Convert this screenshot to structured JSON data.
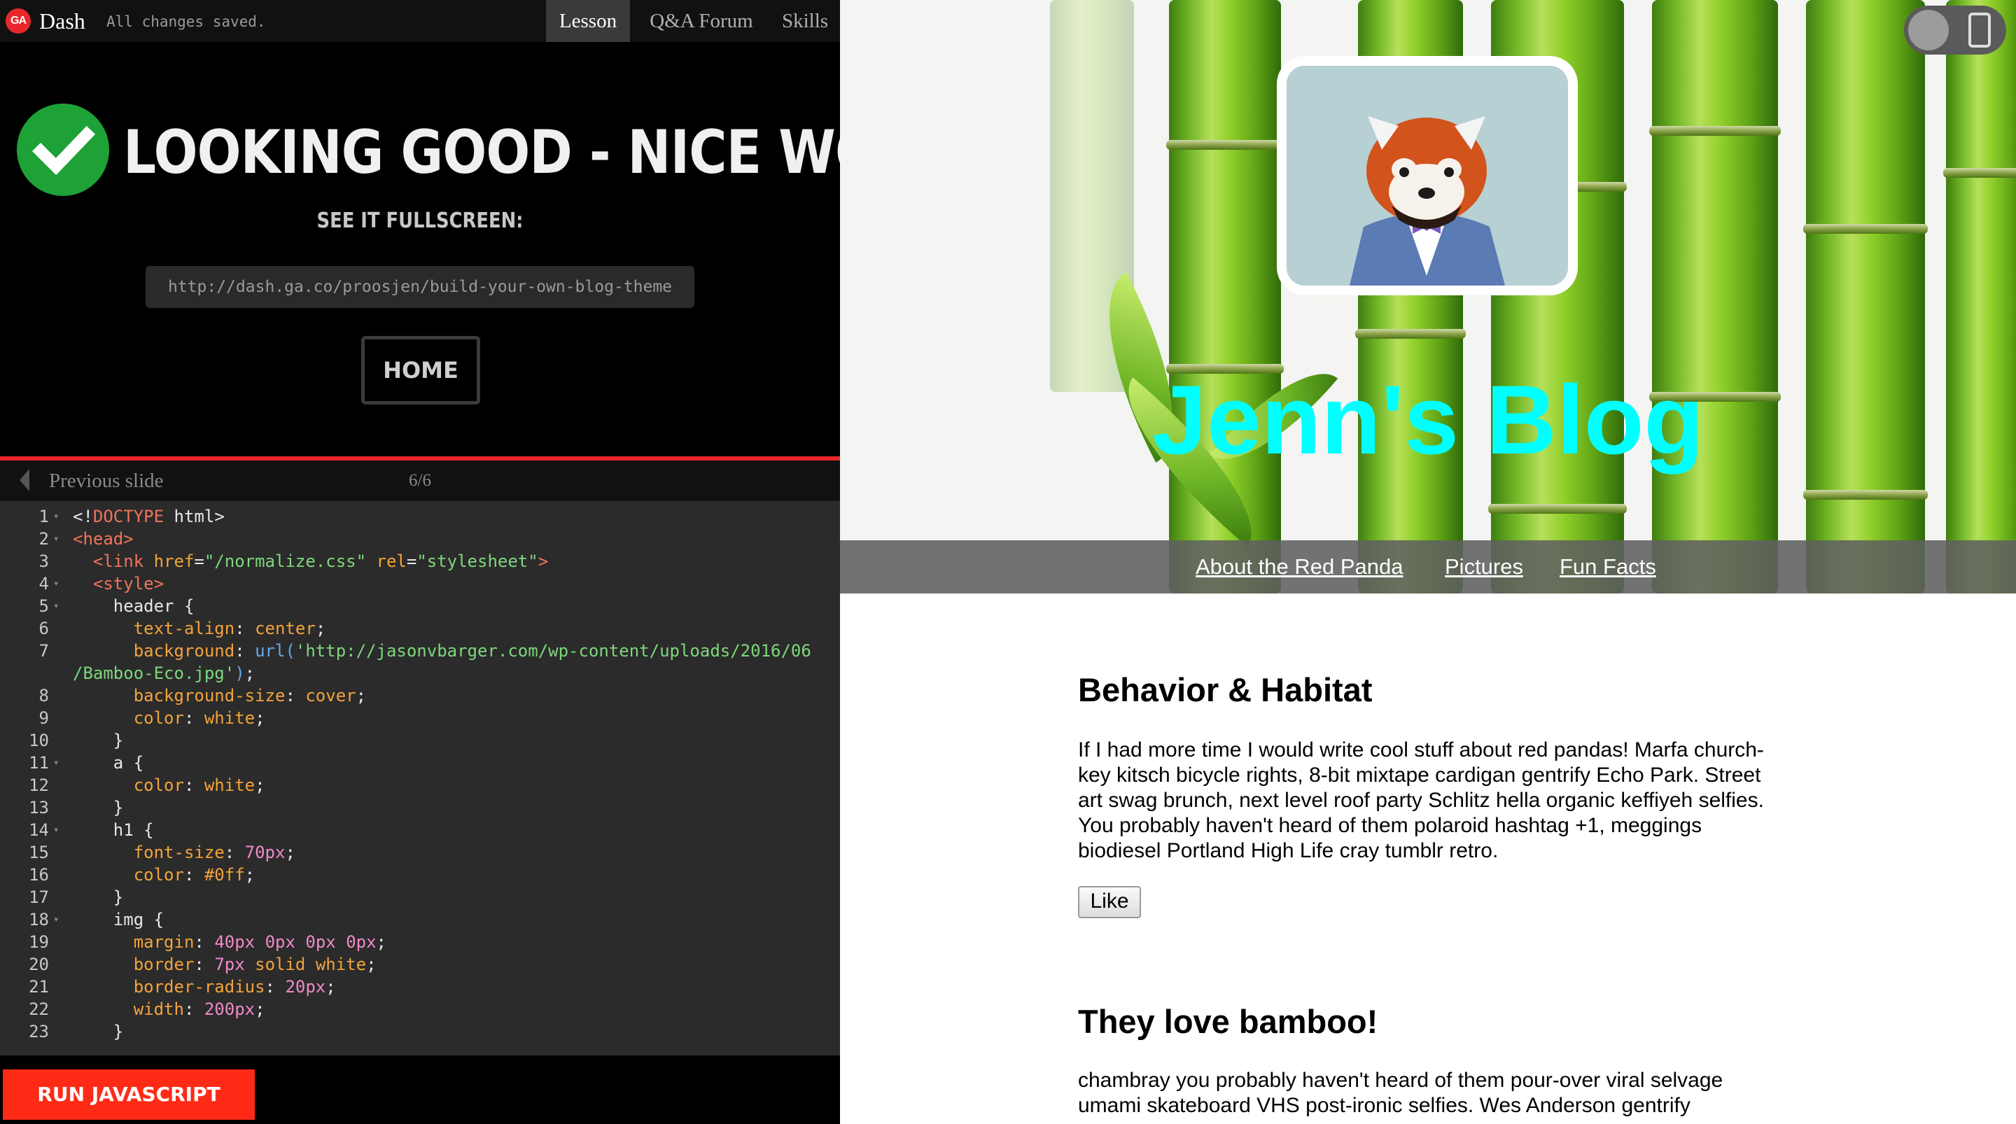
{
  "topbar": {
    "logo_text": "GA",
    "app_name": "Dash",
    "save_status": "All changes saved.",
    "tabs": [
      {
        "label": "Lesson",
        "active": true
      },
      {
        "label": "Q&A Forum",
        "active": false
      },
      {
        "label": "Skills",
        "active": false
      }
    ]
  },
  "success": {
    "title": "LOOKING GOOD - NICE WORK!",
    "fullscreen_label": "SEE IT FULLSCREEN:",
    "url": "http://dash.ga.co/proosjen/build-your-own-blog-theme",
    "home_label": "HOME"
  },
  "slide_nav": {
    "prev_label": "Previous slide",
    "counter": "6/6"
  },
  "editor": {
    "lines": [
      {
        "n": "1",
        "fold": true
      },
      {
        "n": "2",
        "fold": true
      },
      {
        "n": "3",
        "fold": false
      },
      {
        "n": "4",
        "fold": true
      },
      {
        "n": "5",
        "fold": true
      },
      {
        "n": "6",
        "fold": false
      },
      {
        "n": "7",
        "fold": false
      },
      {
        "n": "",
        "fold": false
      },
      {
        "n": "8",
        "fold": false
      },
      {
        "n": "9",
        "fold": false
      },
      {
        "n": "10",
        "fold": false
      },
      {
        "n": "11",
        "fold": true
      },
      {
        "n": "12",
        "fold": false
      },
      {
        "n": "13",
        "fold": false
      },
      {
        "n": "14",
        "fold": true
      },
      {
        "n": "15",
        "fold": false
      },
      {
        "n": "16",
        "fold": false
      },
      {
        "n": "17",
        "fold": false
      },
      {
        "n": "18",
        "fold": true
      },
      {
        "n": "19",
        "fold": false
      },
      {
        "n": "20",
        "fold": false
      },
      {
        "n": "21",
        "fold": false
      },
      {
        "n": "22",
        "fold": false
      },
      {
        "n": "23",
        "fold": false
      }
    ]
  },
  "run_label": "RUN JAVASCRIPT",
  "blog": {
    "title": "Jenn's Blog",
    "nav": [
      "About the Red Panda",
      "Pictures",
      "Fun Facts"
    ],
    "posts": [
      {
        "heading": "Behavior & Habitat",
        "body": "If I had more time I would write cool stuff about red pandas! Marfa church-key kitsch bicycle rights, 8-bit mixtape cardigan gentrify Echo Park. Street art swag brunch, next level roof party Schlitz hella organic keffiyeh selfies. You probably haven't heard of them polaroid hashtag +1, meggings biodiesel Portland High Life cray tumblr retro.",
        "like_label": "Like"
      },
      {
        "heading": "They love bamboo!",
        "body": "chambray you probably haven't heard of them pour-over viral selvage umami skateboard VHS post-ironic selfies. Wes Anderson gentrify"
      }
    ]
  },
  "colors": {
    "accent_red": "#e8272b",
    "run_button": "#ff2a16",
    "success_green": "#1ea237",
    "blog_title": "#00ffff",
    "nav_bar": "#606060"
  },
  "icons": {
    "success": "check-circle-icon",
    "prev": "caret-left-icon",
    "toggle": "toggle-switch-icon",
    "device": "phone-icon"
  }
}
